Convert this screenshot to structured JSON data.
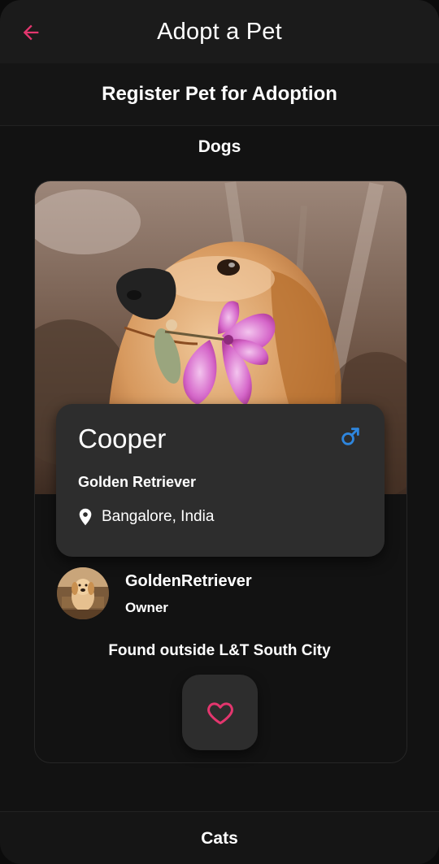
{
  "appbar": {
    "title": "Adopt a Pet",
    "back_icon": "arrow-left-icon"
  },
  "register": {
    "label": "Register Pet for Adoption"
  },
  "categories": {
    "current": "Dogs",
    "next": "Cats"
  },
  "pet": {
    "name": "Cooper",
    "breed": "Golden Retriever",
    "location": "Bangalore, India",
    "gender_icon": "male-icon",
    "location_icon": "location-pin-icon"
  },
  "owner": {
    "name": "GoldenRetriever",
    "role": "Owner"
  },
  "found_text": "Found outside L&T South City",
  "favorite_icon": "heart-outline-icon",
  "colors": {
    "accent": "#e3366e",
    "gender": "#2e86de",
    "card": "#2d2d2d",
    "background": "#121212",
    "appbar": "#1b1b1b"
  }
}
